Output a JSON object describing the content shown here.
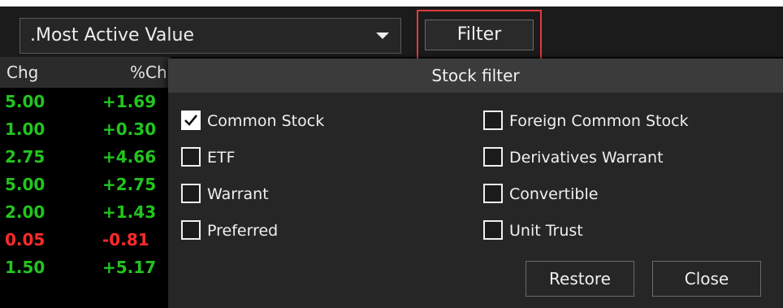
{
  "toolbar": {
    "select_value": ".Most Active Value",
    "filter_label": "Filter"
  },
  "table": {
    "headers": [
      "Chg",
      "%Ch"
    ],
    "rows": [
      {
        "chg": "5.00",
        "pct": "+1.69",
        "trend": "up"
      },
      {
        "chg": "1.00",
        "pct": "+0.30",
        "trend": "up"
      },
      {
        "chg": "2.75",
        "pct": "+4.66",
        "trend": "up"
      },
      {
        "chg": "5.00",
        "pct": "+2.75",
        "trend": "up"
      },
      {
        "chg": "2.00",
        "pct": "+1.43",
        "trend": "up"
      },
      {
        "chg": "0.05",
        "pct": "-0.81",
        "trend": "down"
      },
      {
        "chg": "1.50",
        "pct": "+5.17",
        "trend": "up"
      }
    ]
  },
  "modal": {
    "title": "Stock filter",
    "options_left": [
      {
        "label": "Common Stock",
        "checked": true
      },
      {
        "label": "ETF",
        "checked": false
      },
      {
        "label": "Warrant",
        "checked": false
      },
      {
        "label": "Preferred",
        "checked": false
      }
    ],
    "options_right": [
      {
        "label": "Foreign Common Stock",
        "checked": false
      },
      {
        "label": "Derivatives Warrant",
        "checked": false
      },
      {
        "label": "Convertible",
        "checked": false
      },
      {
        "label": "Unit Trust",
        "checked": false
      }
    ],
    "restore_label": "Restore",
    "close_label": "Close"
  },
  "icons": {
    "dropdown": "chevron-down-icon",
    "check": "checkmark-icon"
  },
  "colors": {
    "up": "#22c51e",
    "down": "#ff2a2a",
    "highlight": "#e03c3c"
  }
}
